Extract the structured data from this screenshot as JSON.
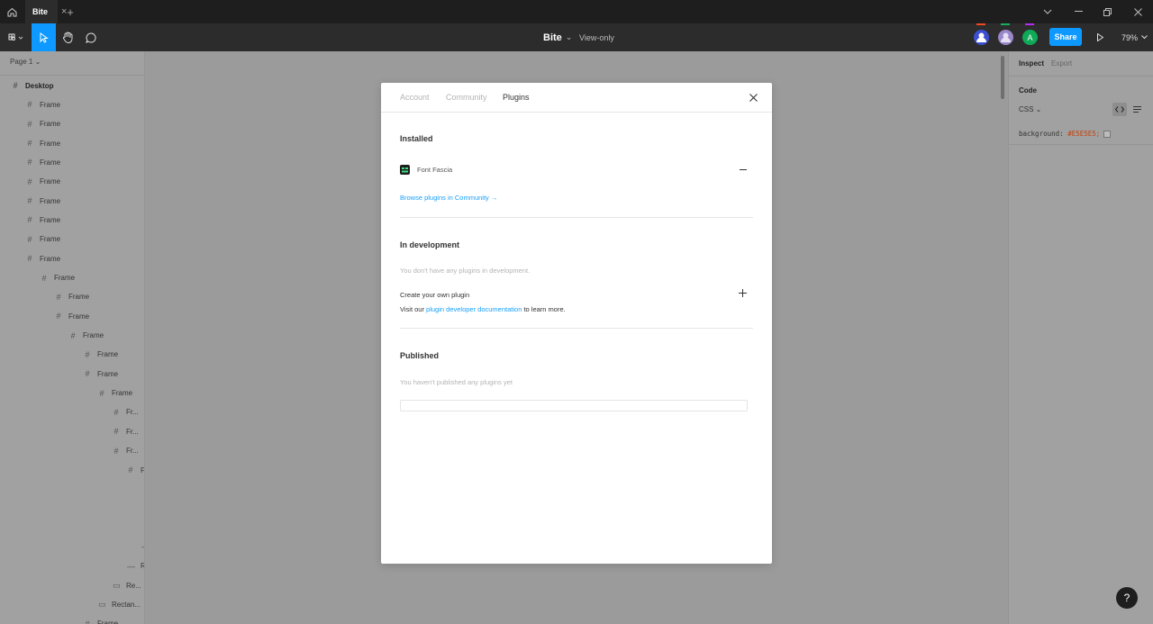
{
  "tabbar": {
    "tab_label": "Bite",
    "tab_close": "×",
    "tab_add": "+"
  },
  "toolbar": {
    "file_title": "Bite",
    "file_caret": "⌄",
    "view_mode": "View-only",
    "share_label": "Share",
    "zoom_label": "79%",
    "avatars": [
      {
        "initial": "",
        "color": "#3d4fd1",
        "mark": "#f24822"
      },
      {
        "initial": "",
        "color": "#9a86c9",
        "mark": "#14ae5c"
      },
      {
        "initial": "A",
        "color": "#0fa958",
        "mark": "#b62cf4"
      }
    ]
  },
  "left_panel": {
    "page_label": "Page 1 ⌄",
    "layers": [
      {
        "label": "Desktop",
        "depth": 0,
        "icon": "#",
        "bold": true
      },
      {
        "label": "Frame",
        "depth": 1,
        "icon": "#"
      },
      {
        "label": "Frame",
        "depth": 1,
        "icon": "#"
      },
      {
        "label": "Frame",
        "depth": 1,
        "icon": "#"
      },
      {
        "label": "Frame",
        "depth": 1,
        "icon": "#"
      },
      {
        "label": "Frame",
        "depth": 1,
        "icon": "#"
      },
      {
        "label": "Frame",
        "depth": 1,
        "icon": "#"
      },
      {
        "label": "Frame",
        "depth": 1,
        "icon": "#"
      },
      {
        "label": "Frame",
        "depth": 1,
        "icon": "#"
      },
      {
        "label": "Frame",
        "depth": 1,
        "icon": "#"
      },
      {
        "label": "Frame",
        "depth": 2,
        "icon": "#"
      },
      {
        "label": "Frame",
        "depth": 3,
        "icon": "#"
      },
      {
        "label": "Frame",
        "depth": 3,
        "icon": "#"
      },
      {
        "label": "Frame",
        "depth": 4,
        "icon": "#"
      },
      {
        "label": "Frame",
        "depth": 5,
        "icon": "#"
      },
      {
        "label": "Frame",
        "depth": 5,
        "icon": "#"
      },
      {
        "label": "Frame",
        "depth": 6,
        "icon": "#"
      },
      {
        "label": "Fr...",
        "depth": 7,
        "icon": "#"
      },
      {
        "label": "Fr...",
        "depth": 7,
        "icon": "#"
      },
      {
        "label": "Fr...",
        "depth": 7,
        "icon": "#"
      },
      {
        "label": "Fı",
        "depth": 8,
        "icon": "#"
      },
      {
        "label": "",
        "depth": 9,
        "icon": "⁝"
      },
      {
        "label": "",
        "depth": 9,
        "icon": ""
      },
      {
        "label": "",
        "depth": 9,
        "icon": ""
      },
      {
        "label": "",
        "depth": 9,
        "icon": "—"
      },
      {
        "label": "R",
        "depth": 8,
        "icon": "—"
      },
      {
        "label": "Re...",
        "depth": 7,
        "icon": "▭"
      },
      {
        "label": "Rectan...",
        "depth": 6,
        "icon": "▭"
      },
      {
        "label": "Frame",
        "depth": 5,
        "icon": "#"
      }
    ]
  },
  "right_panel": {
    "tab_inspect": "Inspect",
    "tab_export": "Export",
    "code_heading": "Code",
    "lang_select": "CSS ⌄",
    "code_line_prop": "background:",
    "code_line_value": "#E5E5E5;",
    "value_color": "#c2410c"
  },
  "modal": {
    "tabs": [
      "Account",
      "Community",
      "Plugins"
    ],
    "active_tab": 2,
    "installed_title": "Installed",
    "plugin_name": "Font Fascia",
    "browse_link": "Browse plugins in Community →",
    "dev_title": "In development",
    "dev_empty": "You don't have any plugins in development.",
    "create_label": "Create your own plugin",
    "visit_prefix": "Visit our ",
    "visit_link": "plugin developer documentation",
    "visit_suffix": " to learn more.",
    "published_title": "Published",
    "published_empty": "You haven't published any plugins yet"
  }
}
